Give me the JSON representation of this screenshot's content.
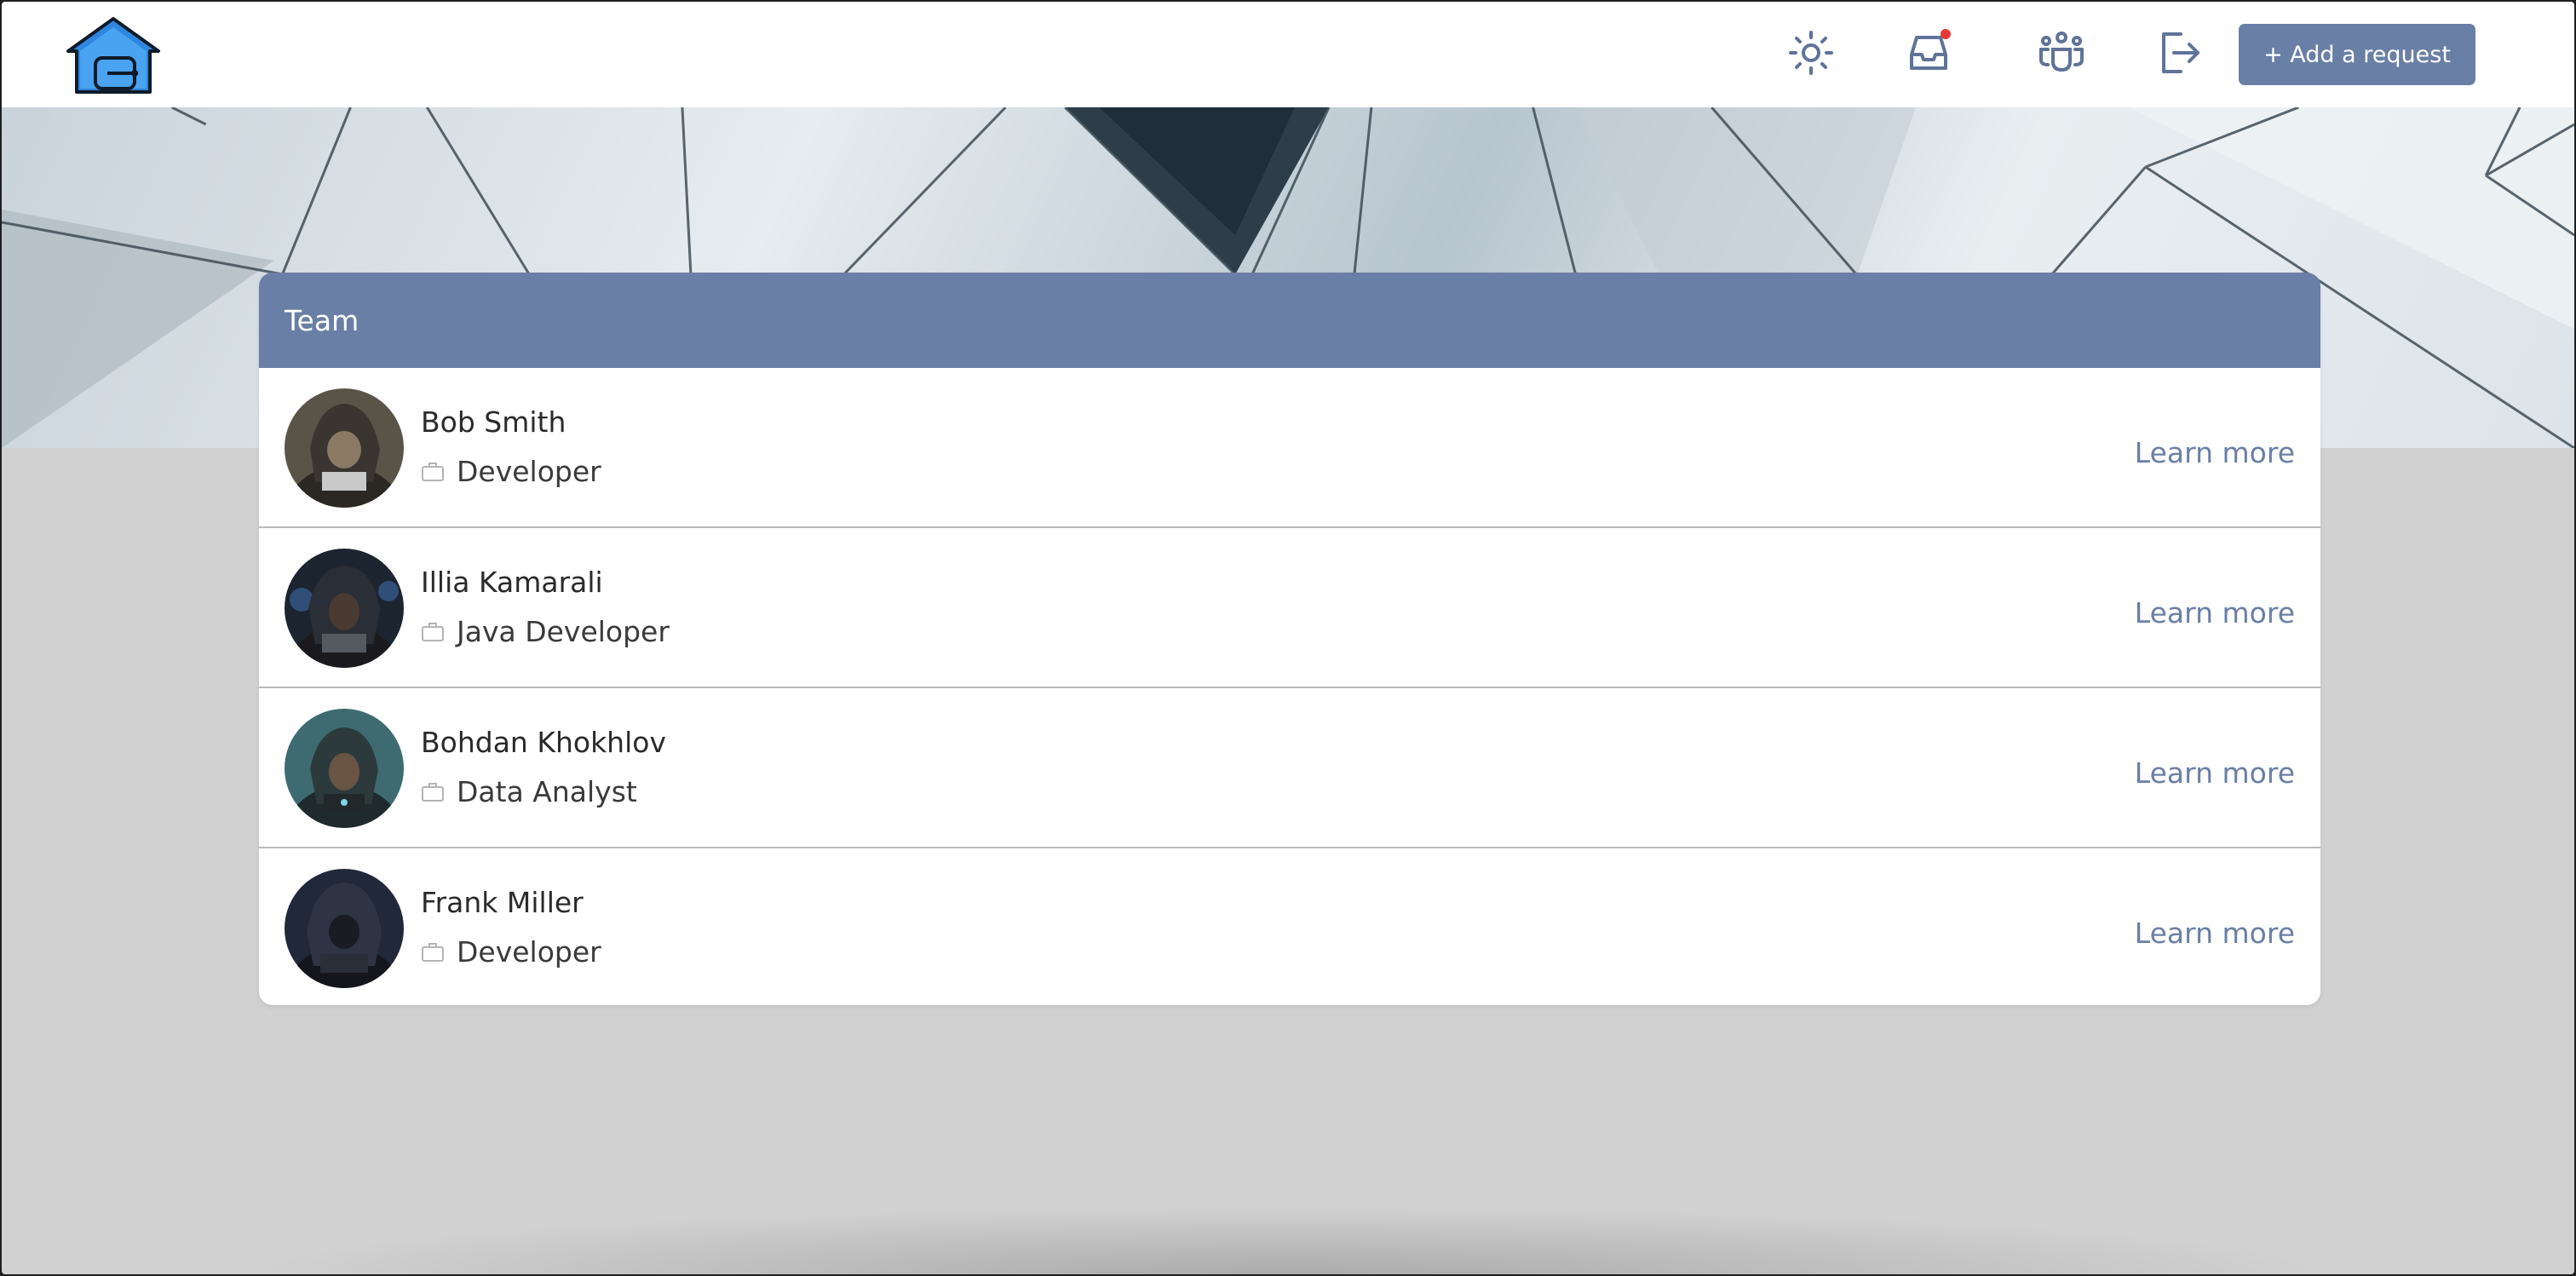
{
  "header": {
    "add_request_label": "+ Add a request",
    "icons": [
      "sun-icon",
      "inbox-icon",
      "team-icon",
      "logout-icon"
    ],
    "notification_dot_color": "#e53935"
  },
  "team": {
    "title": "Team",
    "members": [
      {
        "name": "Bob Smith",
        "role": "Developer",
        "action": "Learn more"
      },
      {
        "name": "Illia Kamarali",
        "role": "Java Developer",
        "action": "Learn more"
      },
      {
        "name": "Bohdan Khokhlov",
        "role": "Data Analyst",
        "action": "Learn more"
      },
      {
        "name": "Frank Miller",
        "role": "Developer",
        "action": "Learn more"
      }
    ]
  },
  "colors": {
    "accent": "#6a7fa6",
    "page_background": "#d1d1d1",
    "logo_blue": "#2f86e0"
  }
}
